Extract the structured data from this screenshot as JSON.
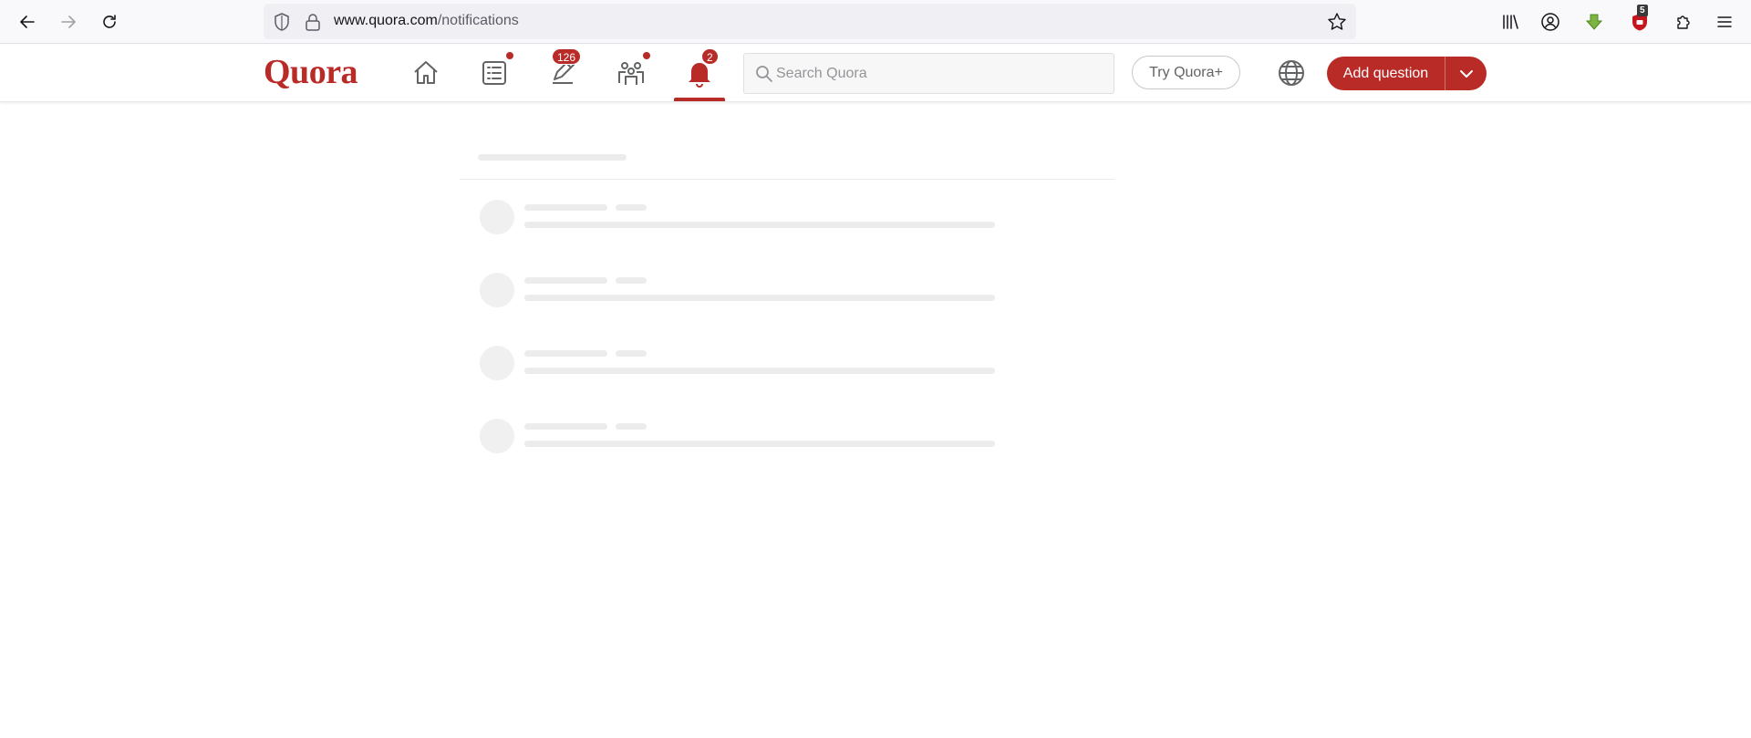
{
  "browser": {
    "url_host": "www.quora.com",
    "url_path": "/notifications",
    "extension_badge": "5"
  },
  "header": {
    "logo": "Quora",
    "nav": [
      {
        "name": "home",
        "badge": null,
        "dot": false,
        "active": false
      },
      {
        "name": "following",
        "badge": null,
        "dot": true,
        "active": false
      },
      {
        "name": "answer",
        "badge": "126",
        "dot": false,
        "active": false
      },
      {
        "name": "spaces",
        "badge": null,
        "dot": true,
        "active": false
      },
      {
        "name": "notifications",
        "badge": "2",
        "dot": false,
        "active": true
      }
    ],
    "search_placeholder": "Search Quora",
    "try_plus_label": "Try Quora+",
    "add_question_label": "Add question"
  },
  "colors": {
    "brand": "#b92b27",
    "skeleton": "#ececec"
  },
  "main": {
    "loading_rows": 4
  }
}
